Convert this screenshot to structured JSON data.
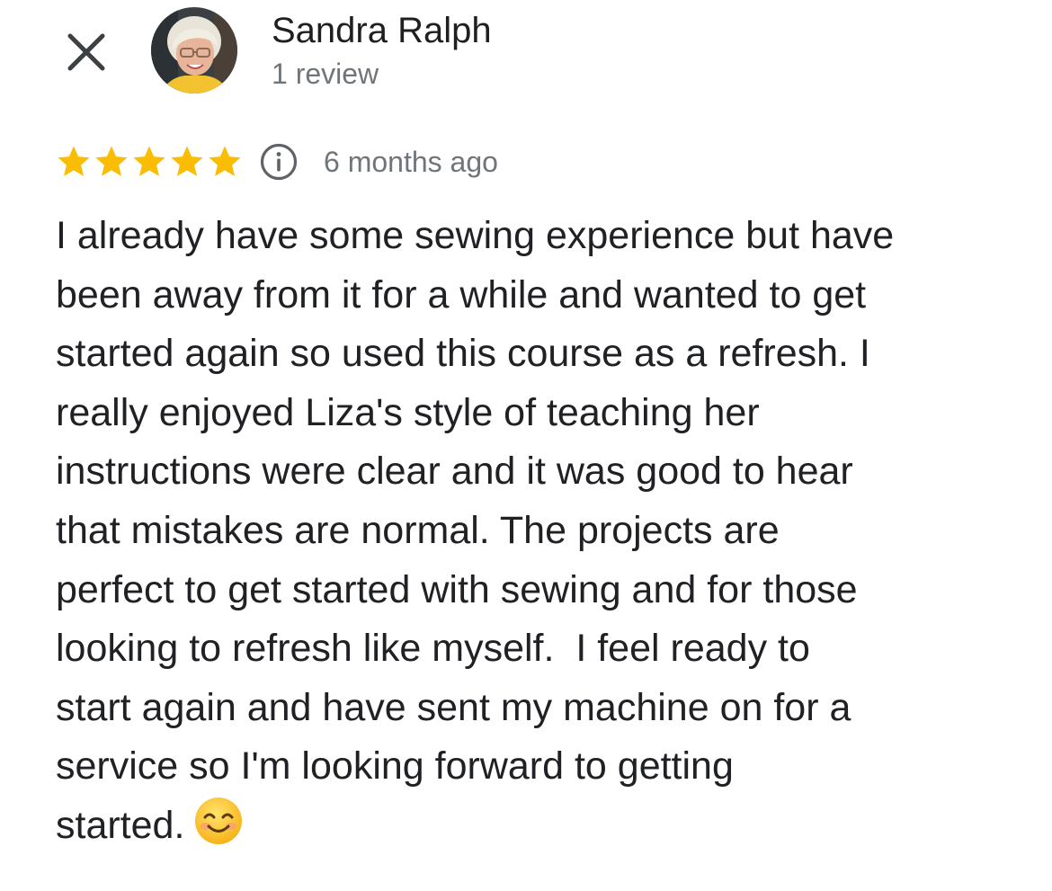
{
  "author": {
    "name": "Sandra Ralph",
    "review_count": "1 review"
  },
  "icons": {
    "close": "close-icon",
    "avatar": "profile-photo",
    "star": "star-icon",
    "info": "info-icon",
    "emoji": "smiling-face-emoji"
  },
  "review": {
    "rating": 5,
    "rating_max": 5,
    "date": "6 months ago",
    "lines": [
      "I already have some sewing experience but have",
      "been away from it for a while and wanted to get",
      "started again so used this course as a refresh. I",
      "really enjoyed Liza's style of teaching her",
      "instructions were clear and it was good to hear",
      "that mistakes are normal. The projects are",
      "perfect to get started with sewing and for those",
      "looking to refresh like myself.  I feel ready to",
      "start again and have sent my machine on for a",
      "service so I'm looking forward to getting",
      "started."
    ]
  },
  "colors": {
    "star": "#fbbc04",
    "secondary_text": "#70757a",
    "primary_text": "#202124"
  }
}
